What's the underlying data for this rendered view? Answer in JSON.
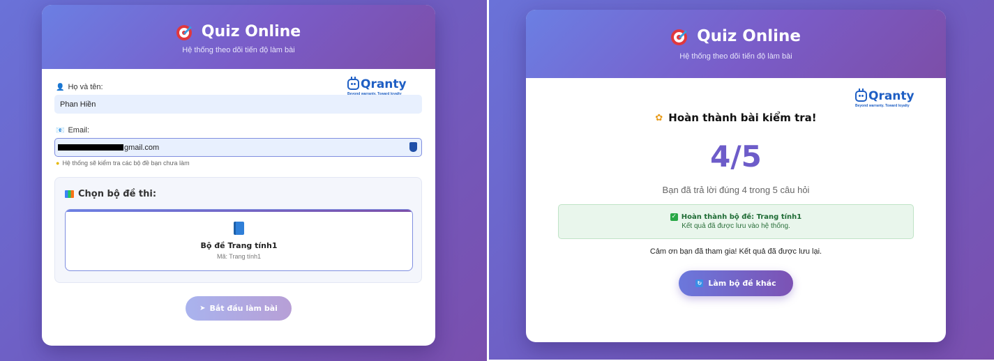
{
  "left": {
    "header": {
      "title": "Quiz Online",
      "subtitle": "Hệ thống theo dõi tiến độ làm bài",
      "icon": "target-icon"
    },
    "logo": {
      "name": "Qranty",
      "tagline": "Beyond warranty. Toward loyalty"
    },
    "form": {
      "name_label": "Họ và tên:",
      "name_value": "Phan Hiền",
      "email_label": "Email:",
      "email_value_visible": "gmail.com",
      "email_hint": "Hệ thống sẽ kiểm tra các bộ đề bạn chưa làm"
    },
    "quiz_select": {
      "title": "Chọn bộ đề thi:",
      "option_name": "Bộ đề Trang tính1",
      "option_code": "Mã: Trang tính1"
    },
    "start_button": "Bắt đầu làm bài"
  },
  "right": {
    "header": {
      "title": "Quiz Online",
      "subtitle": "Hệ thống theo dõi tiến độ làm bài",
      "icon": "target-icon"
    },
    "logo": {
      "name": "Qranty",
      "tagline": "Beyond warranty. Toward loyalty"
    },
    "result": {
      "title": "Hoàn thành bài kiểm tra!",
      "score": "4/5",
      "score_desc": "Bạn đã trả lời đúng 4 trong 5 câu hỏi",
      "success_title": "Hoàn thành bộ đề: Trang tính1",
      "success_msg": "Kết quả đã được lưu vào hệ thống.",
      "thanks": "Cảm ơn bạn đã tham gia! Kết quả đã được lưu lại."
    },
    "retry_button": "Làm bộ đề khác"
  },
  "colors": {
    "accent": "#6d5cc9",
    "success": "#28a745",
    "logo": "#1f5fc4"
  }
}
